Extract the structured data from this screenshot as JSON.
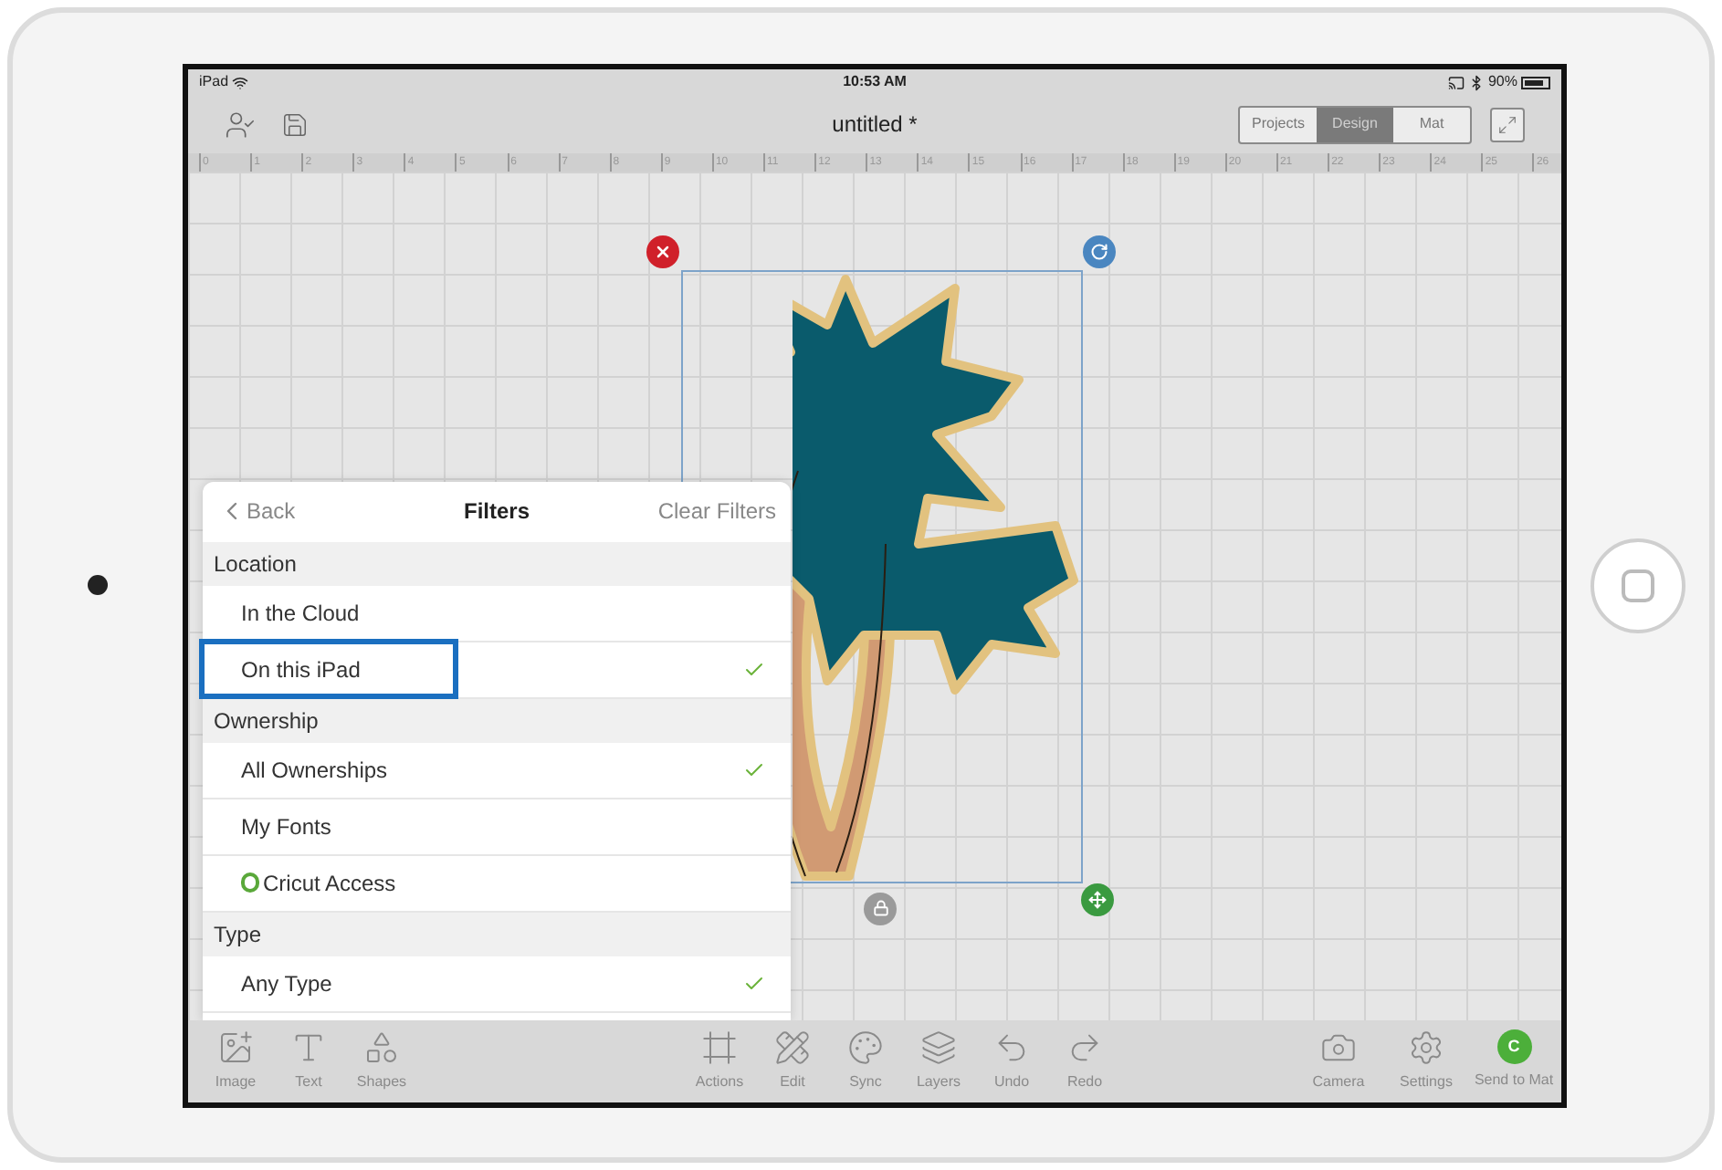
{
  "status_bar": {
    "device": "iPad",
    "time": "10:53 AM",
    "battery": "90%"
  },
  "toolbar": {
    "title": "untitled *",
    "modes": [
      {
        "label": "Projects",
        "selected": false
      },
      {
        "label": "Design",
        "selected": true
      },
      {
        "label": "Mat",
        "selected": false
      }
    ]
  },
  "ruler_marks": [
    "0",
    "1",
    "2",
    "3",
    "4",
    "5",
    "6",
    "7",
    "8",
    "9",
    "10",
    "11",
    "12",
    "13",
    "14",
    "15",
    "16",
    "17",
    "18",
    "19",
    "20",
    "21",
    "22",
    "23",
    "24",
    "25",
    "26"
  ],
  "filters": {
    "back": "Back",
    "title": "Filters",
    "clear": "Clear Filters",
    "rows": [
      {
        "kind": "section",
        "label": "Location"
      },
      {
        "kind": "option",
        "label": "In the Cloud",
        "checked": false,
        "highlighted": false
      },
      {
        "kind": "option",
        "label": "On this iPad",
        "checked": true,
        "highlighted": true
      },
      {
        "kind": "section",
        "label": "Ownership"
      },
      {
        "kind": "option",
        "label": "All Ownerships",
        "checked": true,
        "highlighted": false
      },
      {
        "kind": "option",
        "label": "My Fonts",
        "checked": false,
        "highlighted": false
      },
      {
        "kind": "access",
        "label": "Cricut Access",
        "checked": false,
        "highlighted": false
      },
      {
        "kind": "section",
        "label": "Type"
      },
      {
        "kind": "option",
        "label": "Any Type",
        "checked": true,
        "highlighted": false
      }
    ]
  },
  "bottom_toolbar": {
    "left": [
      {
        "kind": "image",
        "label": "Image"
      },
      {
        "kind": "text",
        "label": "Text"
      },
      {
        "kind": "shapes",
        "label": "Shapes"
      }
    ],
    "center": [
      {
        "kind": "actions",
        "label": "Actions"
      },
      {
        "kind": "edit",
        "label": "Edit"
      },
      {
        "kind": "sync",
        "label": "Sync"
      },
      {
        "kind": "layers",
        "label": "Layers"
      },
      {
        "kind": "undo",
        "label": "Undo"
      },
      {
        "kind": "redo",
        "label": "Redo"
      }
    ],
    "right": [
      {
        "kind": "camera",
        "label": "Camera"
      },
      {
        "kind": "settings",
        "label": "Settings"
      },
      {
        "kind": "send",
        "label": "Send to Mat",
        "badge": "C"
      }
    ]
  }
}
